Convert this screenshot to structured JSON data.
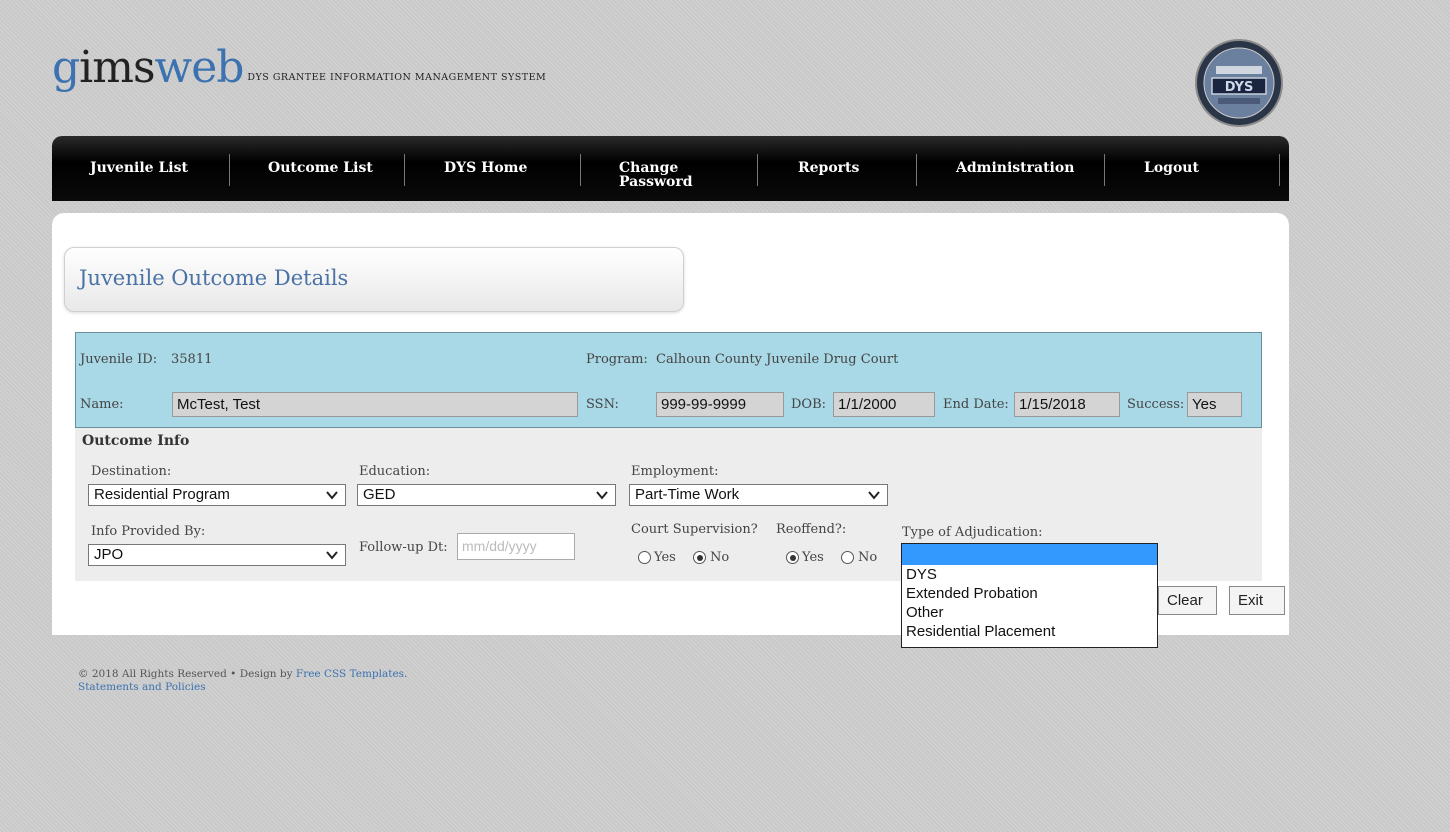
{
  "header": {
    "logo_part1": "g",
    "logo_part2": "ims",
    "logo_part3": "web",
    "subtitle": "DYS Grantee Information Management System",
    "seal_text": "DYS"
  },
  "nav": {
    "items": [
      "Juvenile List",
      "Outcome List",
      "DYS Home",
      "Change Password",
      "Reports",
      "Administration",
      "Logout"
    ]
  },
  "page": {
    "title": "Juvenile Outcome Details"
  },
  "juvenile": {
    "id_label": "Juvenile ID:",
    "id_value": "35811",
    "program_label": "Program:",
    "program_value": "Calhoun County Juvenile Drug Court",
    "name_label": "Name:",
    "name_value": "McTest, Test",
    "ssn_label": "SSN:",
    "ssn_value": "999-99-9999",
    "dob_label": "DOB:",
    "dob_value": "1/1/2000",
    "end_date_label": "End Date:",
    "end_date_value": "1/15/2018",
    "success_label": "Success:",
    "success_value": "Yes"
  },
  "outcome": {
    "section_title": "Outcome Info",
    "destination_label": "Destination:",
    "destination_value": "Residential Program",
    "education_label": "Education:",
    "education_value": "GED",
    "employment_label": "Employment:",
    "employment_value": "Part-Time Work",
    "info_provided_label": "Info Provided By:",
    "info_provided_value": "JPO",
    "followup_label": "Follow-up Dt:",
    "followup_placeholder": "mm/dd/yyyy",
    "court_supervision_label": "Court Supervision?",
    "court_supervision_yes": "Yes",
    "court_supervision_no": "No",
    "court_supervision_selected": "No",
    "reoffend_label": "Reoffend?:",
    "reoffend_yes": "Yes",
    "reoffend_no": "No",
    "reoffend_selected": "Yes",
    "adjudication_label": "Type of Adjudication:",
    "adjudication_options": [
      "",
      "DYS",
      "Extended Probation",
      "Other",
      "Residential Placement"
    ]
  },
  "buttons": {
    "clear": "Clear",
    "exit": "Exit"
  },
  "footer": {
    "copyright": "©  2018 All Rights Reserved  •  Design by",
    "link": "Free CSS Templates",
    "period": ".",
    "policies": "Statements and Policies"
  },
  "colors": {
    "info_box": "#a9d8e6",
    "title_blue": "#4a72a6",
    "selected_option": "#3399ff"
  }
}
